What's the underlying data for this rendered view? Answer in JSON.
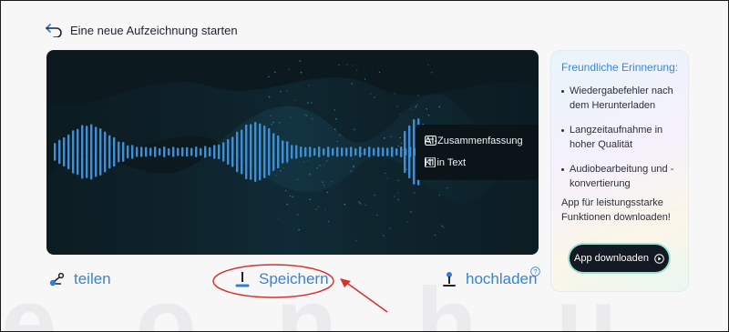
{
  "header": {
    "back_label": "Eine neue Aufzeichnung starten"
  },
  "watermark": "e o n h u",
  "waveform": {
    "ai_menu": [
      {
        "label": "AI-Zusammenfassung",
        "icon": "summary-icon"
      },
      {
        "label": "KI in Text",
        "icon": "text-icon"
      }
    ]
  },
  "actions": {
    "share_label": "teilen",
    "save_label": "Speichern",
    "upload_label": "hochladen"
  },
  "reminder": {
    "heading": "Freundliche Erinnerung:",
    "bullets": [
      "Wiedergabefehler nach dem Herunterladen",
      "Langzeitaufnahme in hoher Qualität",
      "Audiobearbeitung und -konvertierung"
    ],
    "promo": "App für leistungsstarke Funktionen downloaden!",
    "button_label": "App downloaden"
  },
  "colors": {
    "accent": "#3a82d6",
    "annotation": "#d9302b",
    "panel": "#0c1a20",
    "wave": "#3d8fd8"
  }
}
